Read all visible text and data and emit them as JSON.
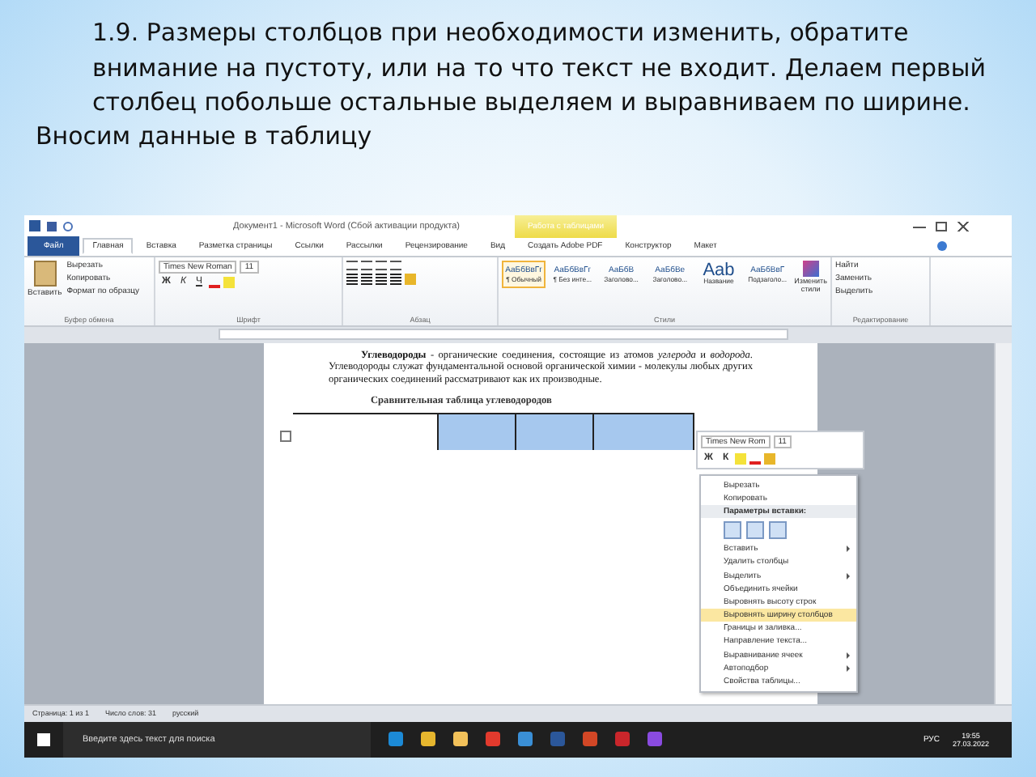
{
  "instructions": {
    "paragraph": "1.9. Размеры столбцов при необходимости изменить, обратите внимание на пустоту, или на то что текст не входит. Делаем первый столбец побольше остальные выделяем и выравниваем по ширине.",
    "note": "Вносим данные в таблицу"
  },
  "word_window": {
    "title": "Документ1 - Microsoft Word (Сбой активации продукта)",
    "contextual_tab": "Работа с таблицами",
    "tabs": [
      {
        "label": "Файл",
        "kind": "file",
        "selected": false
      },
      {
        "label": "Главная",
        "kind": "tab",
        "selected": true
      },
      {
        "label": "Вставка",
        "kind": "tab",
        "selected": false
      },
      {
        "label": "Разметка страницы",
        "kind": "tab",
        "selected": false
      },
      {
        "label": "Ссылки",
        "kind": "tab",
        "selected": false
      },
      {
        "label": "Рассылки",
        "kind": "tab",
        "selected": false
      },
      {
        "label": "Рецензирование",
        "kind": "tab",
        "selected": false
      },
      {
        "label": "Вид",
        "kind": "tab",
        "selected": false
      },
      {
        "label": "Создать Adobe PDF",
        "kind": "tab",
        "selected": false
      },
      {
        "label": "Конструктор",
        "kind": "tab",
        "selected": false
      },
      {
        "label": "Макет",
        "kind": "tab",
        "selected": false
      }
    ],
    "clipboard": {
      "paste": "Вставить",
      "commands": [
        "Вырезать",
        "Копировать",
        "Формат по образцу"
      ],
      "label": "Буфер обмена"
    },
    "font": {
      "name": "Times New Roman",
      "size": "11",
      "format_buttons": [
        "Ж",
        "К",
        "Ч"
      ],
      "label": "Шрифт"
    },
    "paragraph_group": {
      "label": "Абзац"
    },
    "styles": {
      "items": [
        {
          "sample": "АаБбВвГг",
          "name": "¶ Обычный",
          "selected": true
        },
        {
          "sample": "АаБбВвГг",
          "name": "¶ Без инте...",
          "selected": false
        },
        {
          "sample": "АаБбВ",
          "name": "Заголово...",
          "selected": false
        },
        {
          "sample": "АаБбВе",
          "name": "Заголово...",
          "selected": false
        },
        {
          "sample": "Aab",
          "name": "Название",
          "selected": false
        },
        {
          "sample": "АаБбВвГ",
          "name": "Подзаголо...",
          "selected": false
        }
      ],
      "change": "Изменить стили",
      "label": "Стили"
    },
    "editing": {
      "commands": [
        "Найти",
        "Заменить",
        "Выделить"
      ],
      "label": "Редактирование"
    },
    "document": {
      "paragraph": "**Углеводороды** - органические соединения, состоящие из атомов *углерода* и *водорода*. Углеводороды служат фундаментальной основой органической химии - молекулы любых других органических соединений рассматривают как их производные.",
      "heading": "Сравнительная таблица углеводородов"
    },
    "mini_toolbar": {
      "font": "Times New Rom",
      "size": "11",
      "format_buttons": [
        "Ж",
        "К"
      ]
    },
    "context_menu": [
      {
        "label": "Вырезать",
        "kind": "item",
        "submenu": false,
        "selected": false
      },
      {
        "label": "Копировать",
        "kind": "item",
        "submenu": false,
        "selected": false
      },
      {
        "label": "Параметры вставки:",
        "kind": "header",
        "submenu": false,
        "selected": false
      },
      {
        "kind": "paste_icons"
      },
      {
        "label": "Вставить",
        "kind": "item",
        "submenu": true,
        "selected": false
      },
      {
        "label": "Удалить столбцы",
        "kind": "item",
        "submenu": false,
        "selected": false
      },
      {
        "label": "Выделить",
        "kind": "item",
        "submenu": true,
        "selected": false
      },
      {
        "label": "Объединить ячейки",
        "kind": "item",
        "submenu": false,
        "selected": false
      },
      {
        "label": "Выровнять высоту строк",
        "kind": "item",
        "submenu": false,
        "selected": false
      },
      {
        "label": "Выровнять ширину столбцов",
        "kind": "item",
        "submenu": false,
        "selected": true
      },
      {
        "label": "Границы и заливка...",
        "kind": "item",
        "submenu": false,
        "selected": false
      },
      {
        "label": "Направление текста...",
        "kind": "item",
        "submenu": false,
        "selected": false
      },
      {
        "label": "Выравнивание ячеек",
        "kind": "item",
        "submenu": true,
        "selected": false
      },
      {
        "label": "Автоподбор",
        "kind": "item",
        "submenu": true,
        "selected": false
      },
      {
        "label": "Свойства таблицы...",
        "kind": "item",
        "submenu": false,
        "selected": false
      }
    ],
    "status_bar": [
      "Страница: 1 из 1",
      "Число слов: 31",
      "русский"
    ]
  },
  "taskbar": {
    "search_placeholder": "Введите здесь текст для поиска",
    "language": "РУС",
    "time": "19:55",
    "date": "27.03.2022"
  }
}
